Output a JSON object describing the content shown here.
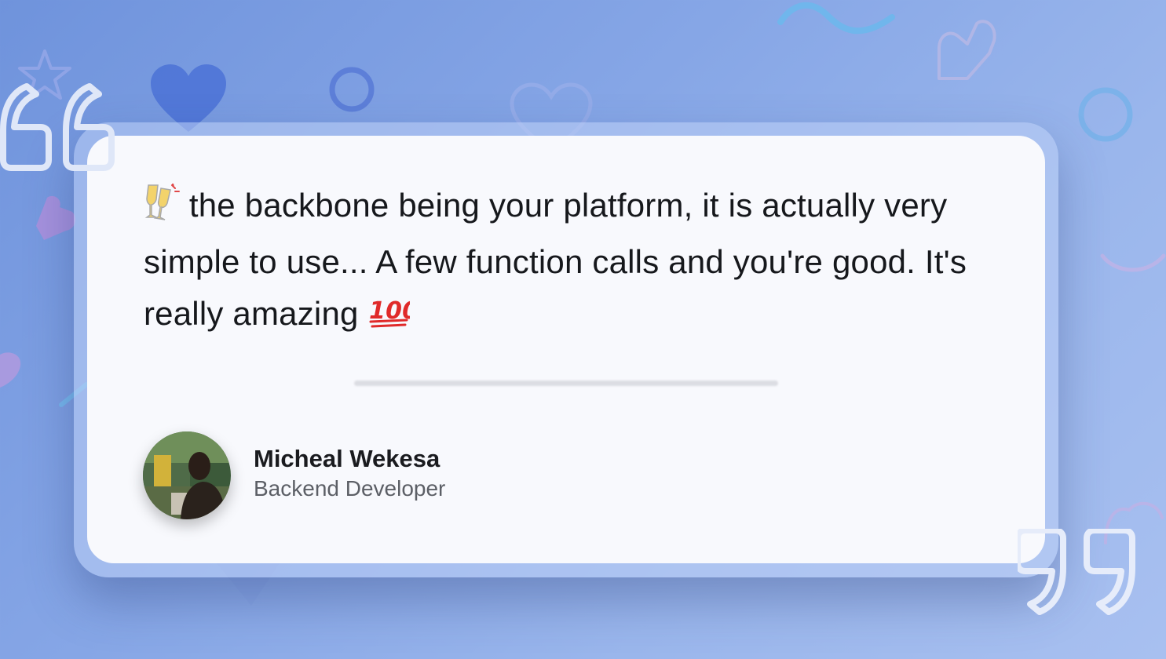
{
  "testimonial": {
    "quote_before": " the backbone being your platform, it is actually very simple to use... A few function calls and you're good. It's really amazing ",
    "author_name": "Micheal Wekesa",
    "author_role": "Backend Developer"
  },
  "icons": {
    "leading_emoji": "clinking-glasses-icon",
    "trailing_emoji": "hundred-points-icon",
    "open_quote": "open-quote-icon",
    "close_quote": "close-quote-icon",
    "decorations": [
      "heart-icon",
      "star-icon",
      "circle-icon",
      "wave-icon"
    ]
  },
  "colors": {
    "background_start": "#6f93dc",
    "background_end": "#a8c0f0",
    "card": "#f8f9fd",
    "text": "#16181c",
    "subtext": "#5c5f66",
    "hundred_red": "#e02a2a"
  }
}
